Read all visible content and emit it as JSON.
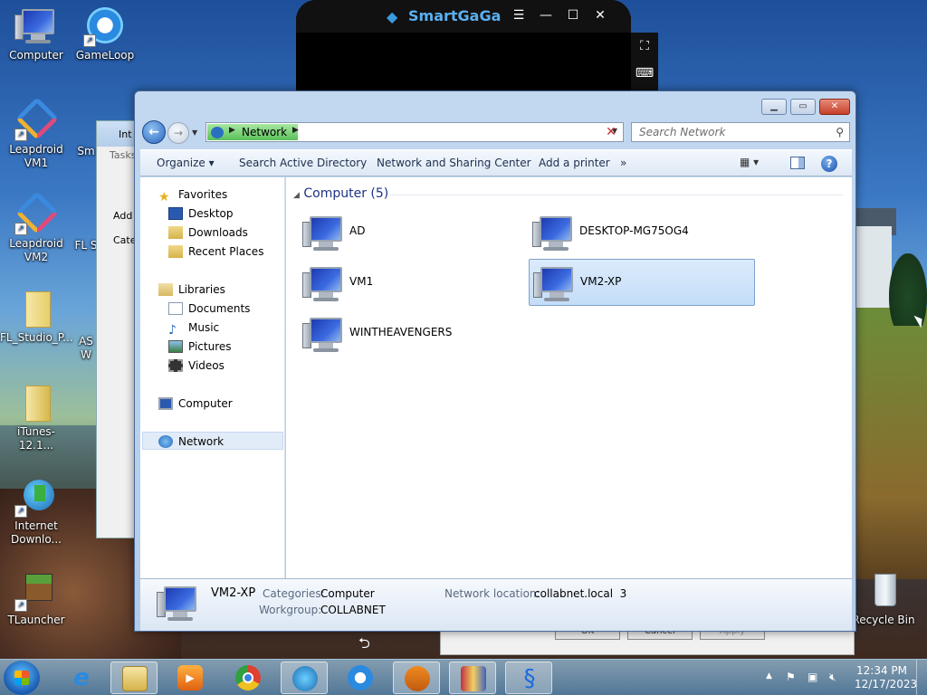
{
  "desktop": {
    "icons": [
      {
        "label": "Computer"
      },
      {
        "label": "GameLoop"
      },
      {
        "label": "Leapdroid VM1"
      },
      {
        "label": "Leapdroid VM2"
      },
      {
        "label": "FL_Studio_P..."
      },
      {
        "label": "iTunes-12.1..."
      },
      {
        "label": "Internet Downlo..."
      },
      {
        "label": "TLauncher"
      },
      {
        "label": "Recycle Bin"
      }
    ],
    "partial_labels": [
      "Sm",
      "FL S",
      "AS",
      "W"
    ]
  },
  "smartgaga": {
    "title": "SmartGaGa",
    "menu_icon": "hamburger-icon",
    "minimize": "—",
    "maximize": "☐",
    "close": "✕",
    "fullscreen_icon": "⛶",
    "keyboard_icon": "⌨"
  },
  "background_window": {
    "title": "Int",
    "tasks": "Tasks",
    "add": "Add",
    "categories": "Cate"
  },
  "behind_dialog": {
    "ok": "OK",
    "cancel": "Cancel",
    "apply": "Apply"
  },
  "explorer": {
    "address": {
      "crumb": "Network"
    },
    "search_placeholder": "Search Network",
    "toolbar": {
      "organize": "Organize",
      "search_ad": "Search Active Directory",
      "network_sharing": "Network and Sharing Center",
      "add_printer": "Add a printer",
      "more": "»"
    },
    "nav": {
      "favorites": "Favorites",
      "desktop": "Desktop",
      "downloads": "Downloads",
      "recent": "Recent Places",
      "libraries": "Libraries",
      "documents": "Documents",
      "music": "Music",
      "pictures": "Pictures",
      "videos": "Videos",
      "computer": "Computer",
      "network": "Network"
    },
    "group_header": "Computer (5)",
    "items": [
      {
        "name": "AD"
      },
      {
        "name": "DESKTOP-MG75OG4"
      },
      {
        "name": "VM1"
      },
      {
        "name": "VM2-XP",
        "selected": true
      },
      {
        "name": "WINTHEAVENGERS"
      }
    ],
    "details": {
      "name": "VM2-XP",
      "categories_label": "Categories:",
      "categories_value": "Computer",
      "workgroup_label": "Workgroup:",
      "workgroup_value": "COLLABNET",
      "netloc_label": "Network location:",
      "netloc_value": "collabnet.local  3"
    }
  },
  "taskbar": {
    "time": "12:34 PM",
    "date": "12/17/2023",
    "apps": [
      "start-button",
      "internet-explorer",
      "windows-explorer",
      "media-player",
      "chrome",
      "internet-download-manager",
      "gameloop",
      "fl-studio",
      "winrar",
      "smartgaga"
    ]
  },
  "colors": {
    "accent": "#1e3287",
    "selection": "#c4ddf8",
    "address_green": "#5ac05a"
  }
}
